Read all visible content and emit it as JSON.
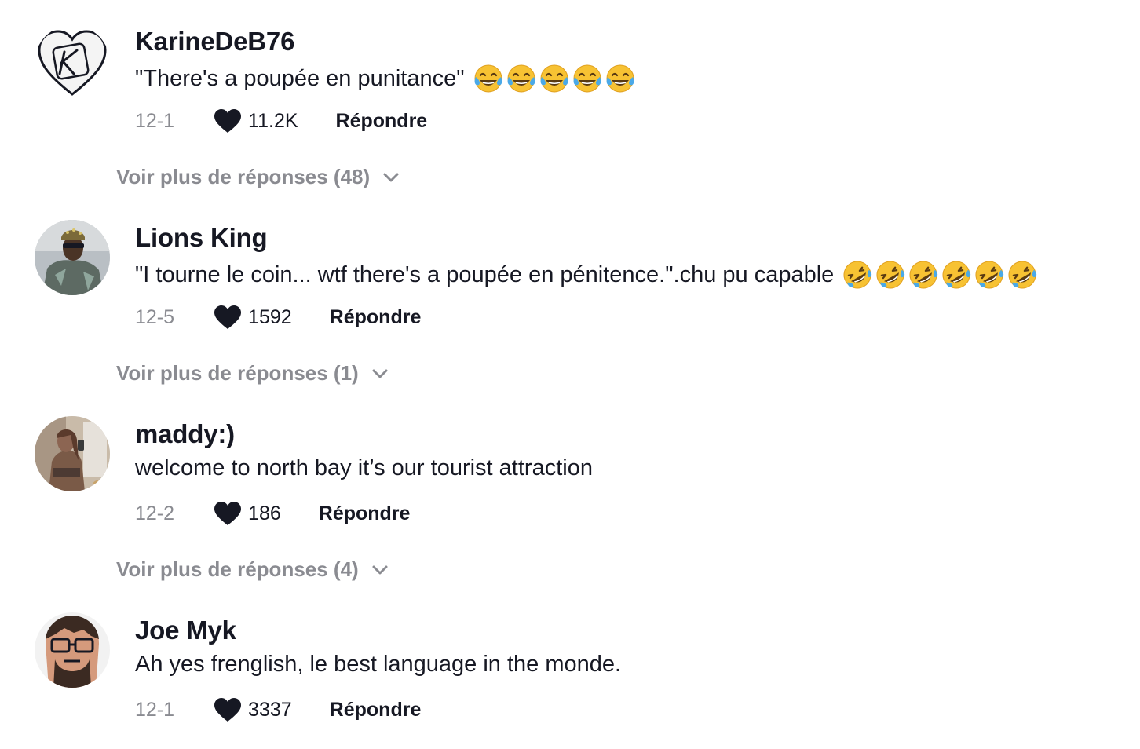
{
  "comments": [
    {
      "username": "KarineDeB76",
      "text": "\"There's a poupée en punitance\"",
      "emoji_name": "face-with-tears-of-joy-icon",
      "emoji_count": 5,
      "date": "12-1",
      "likes": "11.2K",
      "reply_label": "Répondre",
      "more_replies": "Voir plus de réponses (48)"
    },
    {
      "username": "Lions King",
      "text": "\"I tourne le coin... wtf there's a poupée en pénitence.\".chu pu capable",
      "emoji_name": "rolling-on-floor-laughing-icon",
      "emoji_count": 6,
      "date": "12-5",
      "likes": "1592",
      "reply_label": "Répondre",
      "more_replies": "Voir plus de réponses (1)"
    },
    {
      "username": "maddy:)",
      "text": "welcome to north bay it’s our tourist attraction",
      "date": "12-2",
      "likes": "186",
      "reply_label": "Répondre",
      "more_replies": "Voir plus de réponses (4)"
    },
    {
      "username": "Joe Myk",
      "text": "Ah yes frenglish, le best language in the monde.",
      "date": "12-1",
      "likes": "3337",
      "reply_label": "Répondre"
    }
  ],
  "avatar_logo_letter": "K",
  "colors": {
    "text_primary": "#161823",
    "text_secondary": "#8a8b91",
    "background": "#ffffff"
  }
}
